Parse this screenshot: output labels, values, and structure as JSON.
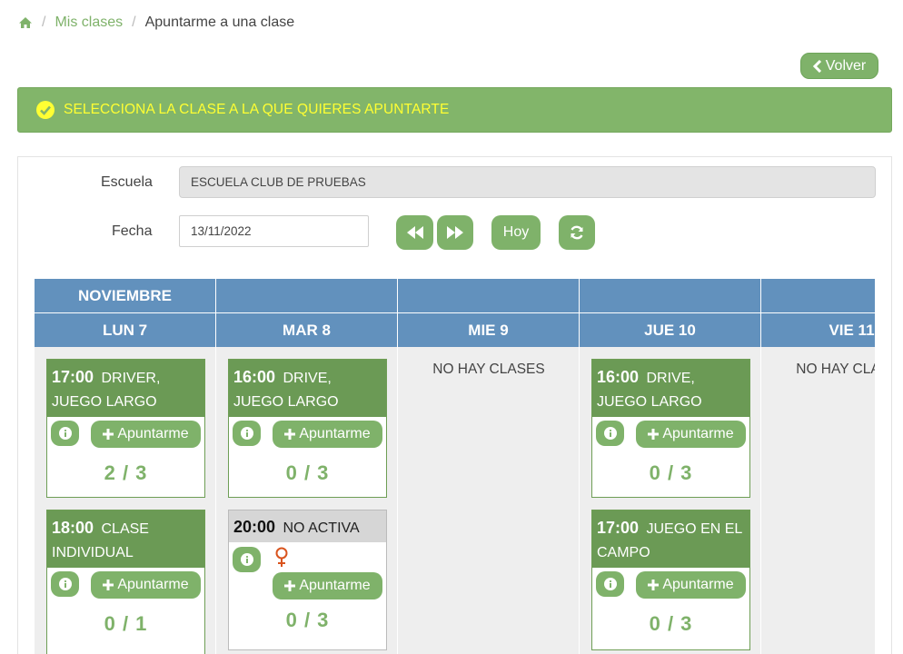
{
  "breadcrumb": {
    "home_icon": "home-icon",
    "link": "Mis clases",
    "current": "Apuntarme a una clase"
  },
  "volver_label": "Volver",
  "alert": {
    "text": "SELECCIONA LA CLASE A LA QUE QUIERES APUNTARTE",
    "text_color": "#ffff33",
    "bg_color": "#82b56a"
  },
  "form": {
    "school_label": "Escuela",
    "school_value": "ESCUELA CLUB DE PRUEBAS",
    "date_label": "Fecha",
    "date_value": "13/11/2022",
    "today_label": "Hoy"
  },
  "calendar": {
    "month": "NOVIEMBRE",
    "days": [
      "LUN 7",
      "MAR 8",
      "MIE 9",
      "JUE 10",
      "VIE 11"
    ],
    "no_classes": "NO HAY CLASES",
    "header_color": "#6291bd",
    "classes": {
      "lun1": {
        "time": "17:00",
        "name": "DRIVER, JUEGO LARGO",
        "count": "2 / 3",
        "join": "Apuntarme"
      },
      "lun2": {
        "time": "18:00",
        "name": "CLASE INDIVIDUAL",
        "count": "0 / 1",
        "join": "Apuntarme"
      },
      "mar1": {
        "time": "16:00",
        "name": "DRIVE, JUEGO LARGO",
        "count": "0 / 3",
        "join": "Apuntarme"
      },
      "mar2": {
        "time": "20:00",
        "name": "NO ACTIVA",
        "count": "0 / 3",
        "join": "Apuntarme",
        "icon": "female-icon"
      },
      "jue1": {
        "time": "16:00",
        "name": "DRIVE, JUEGO LARGO",
        "count": "0 / 3",
        "join": "Apuntarme"
      },
      "jue2": {
        "time": "17:00",
        "name": "JUEGO EN EL CAMPO",
        "count": "0 / 3",
        "join": "Apuntarme"
      }
    }
  }
}
